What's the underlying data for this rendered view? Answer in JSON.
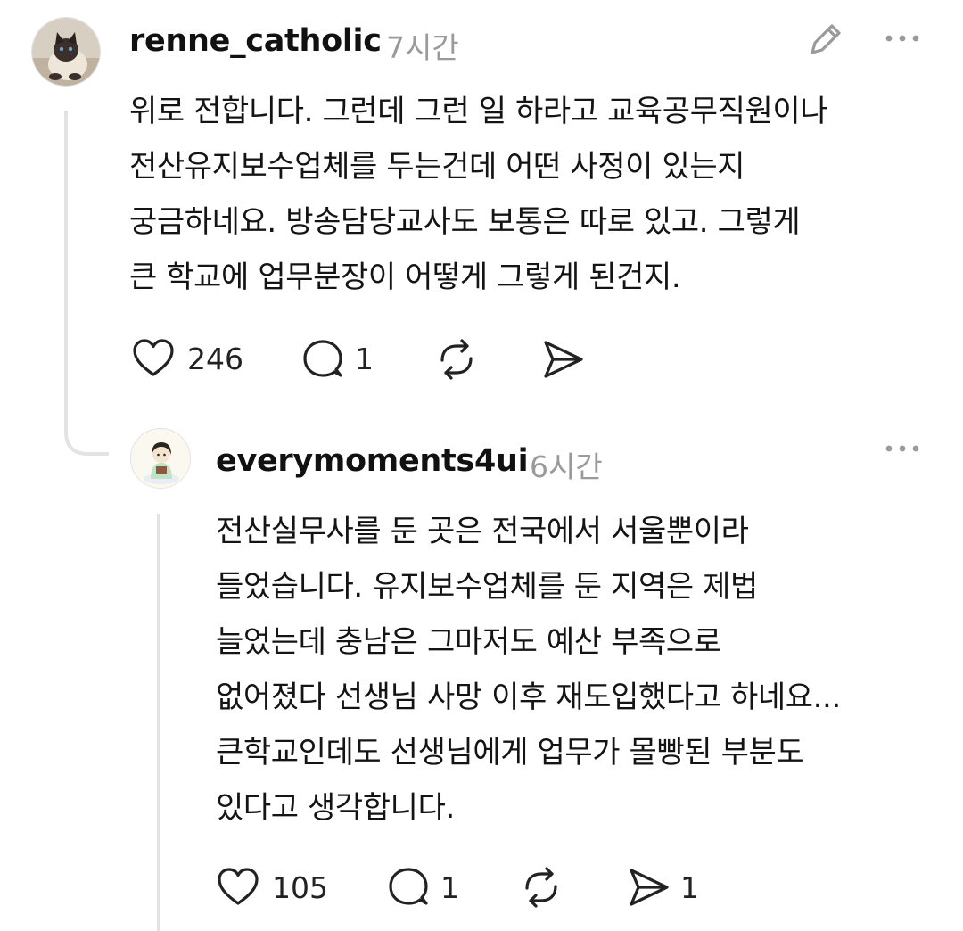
{
  "comment": {
    "username": "renne_catholic",
    "time": "7시간",
    "lines": [
      "위로 전합니다. 그런데 그런 일 하라고 교육공무직원이나",
      "전산유지보수업체를 두는건데 어떤 사정이 있는지",
      "궁금하네요. 방송담당교사도 보통은 따로 있고. 그렇게",
      "큰 학교에 업무분장이 어떻게 그렇게 된건지."
    ],
    "likes": "246",
    "replies": "1"
  },
  "reply": {
    "username": "everymoments4ui",
    "time": "6시간",
    "lines": [
      "전산실무사를 둔 곳은 전국에서 서울뿐이라",
      "들었습니다. 유지보수업체를 둔 지역은 제법",
      "늘었는데 충남은 그마저도 예산 부족으로",
      "없어졌다 선생님 사망 이후 재도입했다고 하네요...",
      "큰학교인데도 선생님에게 업무가 몰빵된 부분도",
      "있다고 생각합니다."
    ],
    "likes": "105",
    "replies": "1",
    "shares": "1"
  },
  "icons": {
    "edit": "pencil-icon",
    "more": "more-icon",
    "like": "heart-icon",
    "reply": "comment-icon",
    "repost": "repost-icon",
    "share": "send-icon"
  },
  "colors": {
    "text": "#111111",
    "muted": "#9a9a9a",
    "thread_line": "#e3e3e3"
  }
}
